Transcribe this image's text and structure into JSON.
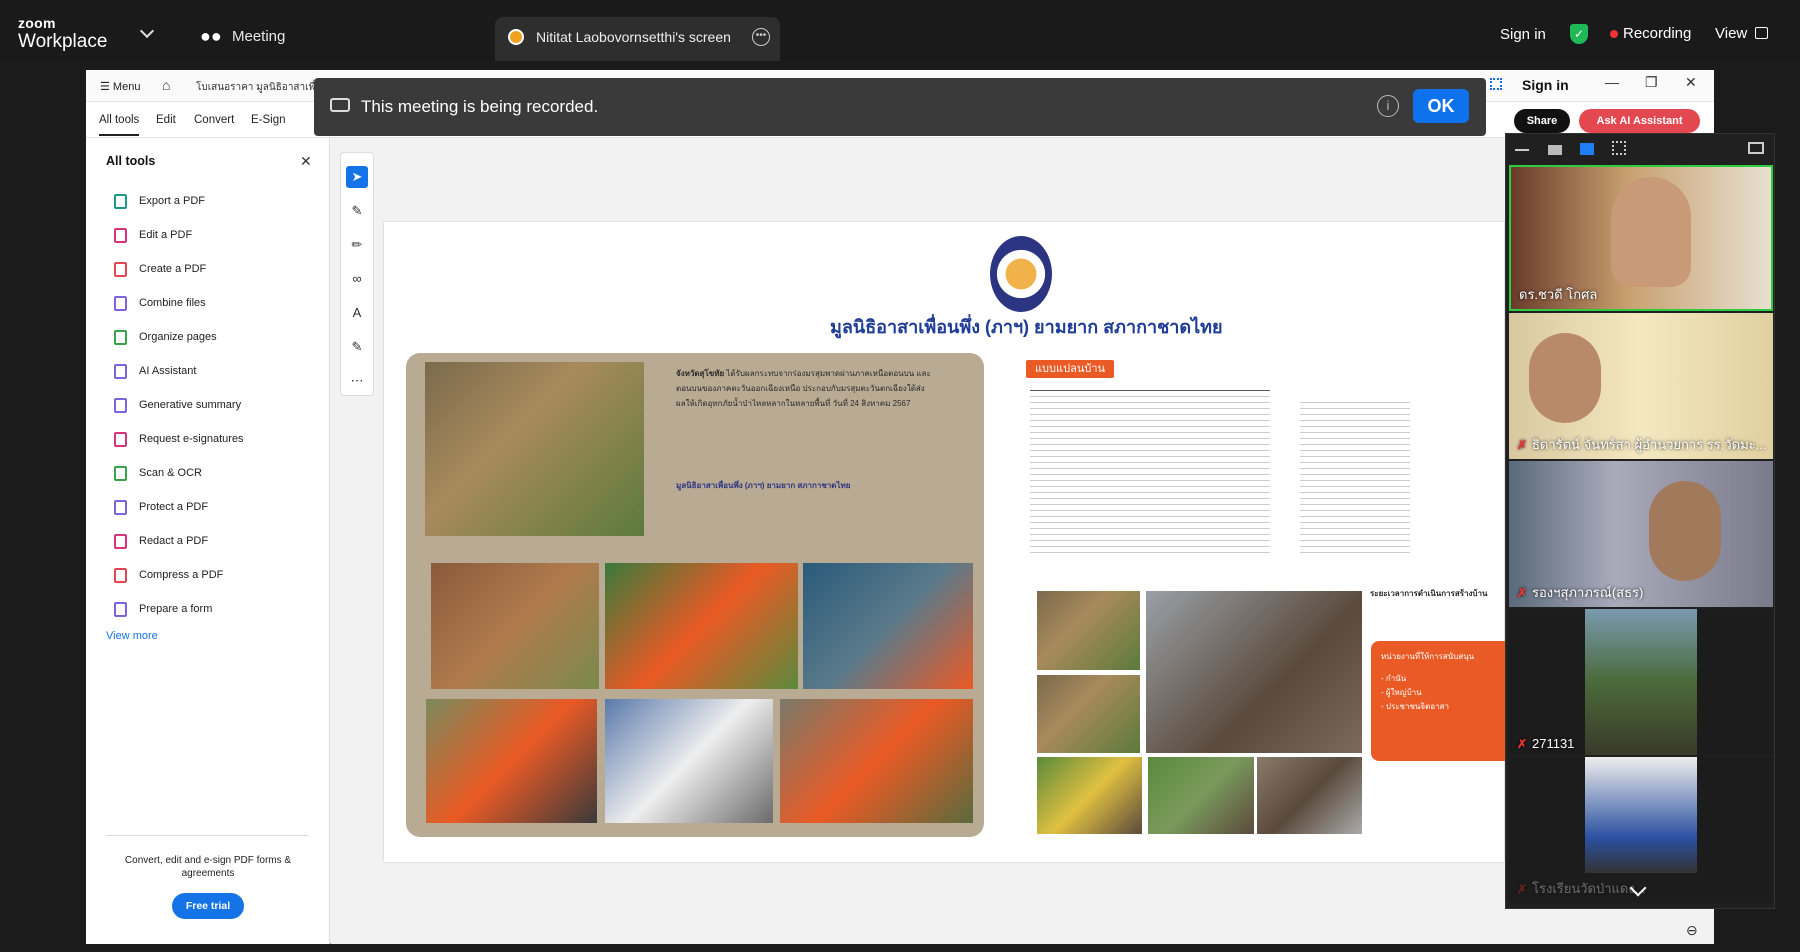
{
  "zoom": {
    "brand_top": "zoom",
    "brand_bottom": "Workplace",
    "meeting_label": "Meeting",
    "share_tab_label": "Nititat Laobovornsetthi's screen",
    "sign_in": "Sign in",
    "recording_label": "Recording",
    "view_label": "View"
  },
  "banner": {
    "message": "This meeting is being recorded.",
    "ok_label": "OK",
    "info_icon": "i"
  },
  "acrobat": {
    "menu_label": "Menu",
    "path": "โบเสนอราคา มูลนิธิอาสาเพื่อนพึ่ง",
    "sign_in": "Sign in",
    "tabs": [
      "All tools",
      "Edit",
      "Convert",
      "E-Sign"
    ],
    "share_label": "Share",
    "ai_label": "Ask AI Assistant",
    "sidebar": {
      "title": "All tools",
      "items": [
        {
          "label": "Export a PDF",
          "color": "#1b9a8c"
        },
        {
          "label": "Edit a PDF",
          "color": "#d4357a"
        },
        {
          "label": "Create a PDF",
          "color": "#e34850"
        },
        {
          "label": "Combine files",
          "color": "#7a64e0"
        },
        {
          "label": "Organize pages",
          "color": "#3aa34a"
        },
        {
          "label": "AI Assistant",
          "color": "#7a64e0"
        },
        {
          "label": "Generative summary",
          "color": "#7a64e0"
        },
        {
          "label": "Request e-signatures",
          "color": "#d4357a"
        },
        {
          "label": "Scan & OCR",
          "color": "#3aa34a"
        },
        {
          "label": "Protect a PDF",
          "color": "#7a64e0"
        },
        {
          "label": "Redact a PDF",
          "color": "#d4357a"
        },
        {
          "label": "Compress a PDF",
          "color": "#e34850"
        },
        {
          "label": "Prepare a form",
          "color": "#7a64e0"
        }
      ],
      "view_more": "View more",
      "promo": "Convert, edit and e-sign PDF forms & agreements",
      "free_trial": "Free trial"
    }
  },
  "document": {
    "title": "มูลนิธิอาสาเพื่อนพึ่ง (ภาฯ) ยามยาก สภากาชาดไทย",
    "plan_tag": "แบบแปลนบ้าน",
    "card_heading": "จังหวัดสุโขทัย",
    "card_text": "ได้รับผลกระทบจากร่องมรสุมพาดผ่านภาคเหนือตอนบน และตอนบนของภาคตะวันออกเฉียงเหนือ ประกอบกับมรสุมตะวันตกเฉียงใต้ส่งผลให้เกิดอุทกภัยน้ำป่าไหลหลากในหลายพื้นที่ วันที่ 24 สิงหาคม 2567",
    "org_name": "มูลนิธิอาสาเพื่อนพึ่ง (ภาฯ) ยามยาก สภากาชาดไทย",
    "right_text": "ระยะเวลาการดำเนินการสร้างบ้าน",
    "orange_panel_title": "หน่วยงานที่ให้การสนับสนุน",
    "orange_panel_items": [
      "- กำนัน",
      "- ผู้ใหญ่บ้าน",
      "- ประชาชนจิตอาสา"
    ]
  },
  "participants": [
    {
      "name": "ดร.ชวดี โกศล",
      "muted": false
    },
    {
      "name": "ธิดารัตน์ จันทร์สา ผู้อำนวยการ รร.วัดมะ...",
      "muted": true
    },
    {
      "name": "รองฯสุภาภรณ์(สธร)",
      "muted": true
    },
    {
      "name": "271131",
      "muted": true
    },
    {
      "name": "โรงเรียนวัดป่าแดง...",
      "muted": true
    }
  ]
}
